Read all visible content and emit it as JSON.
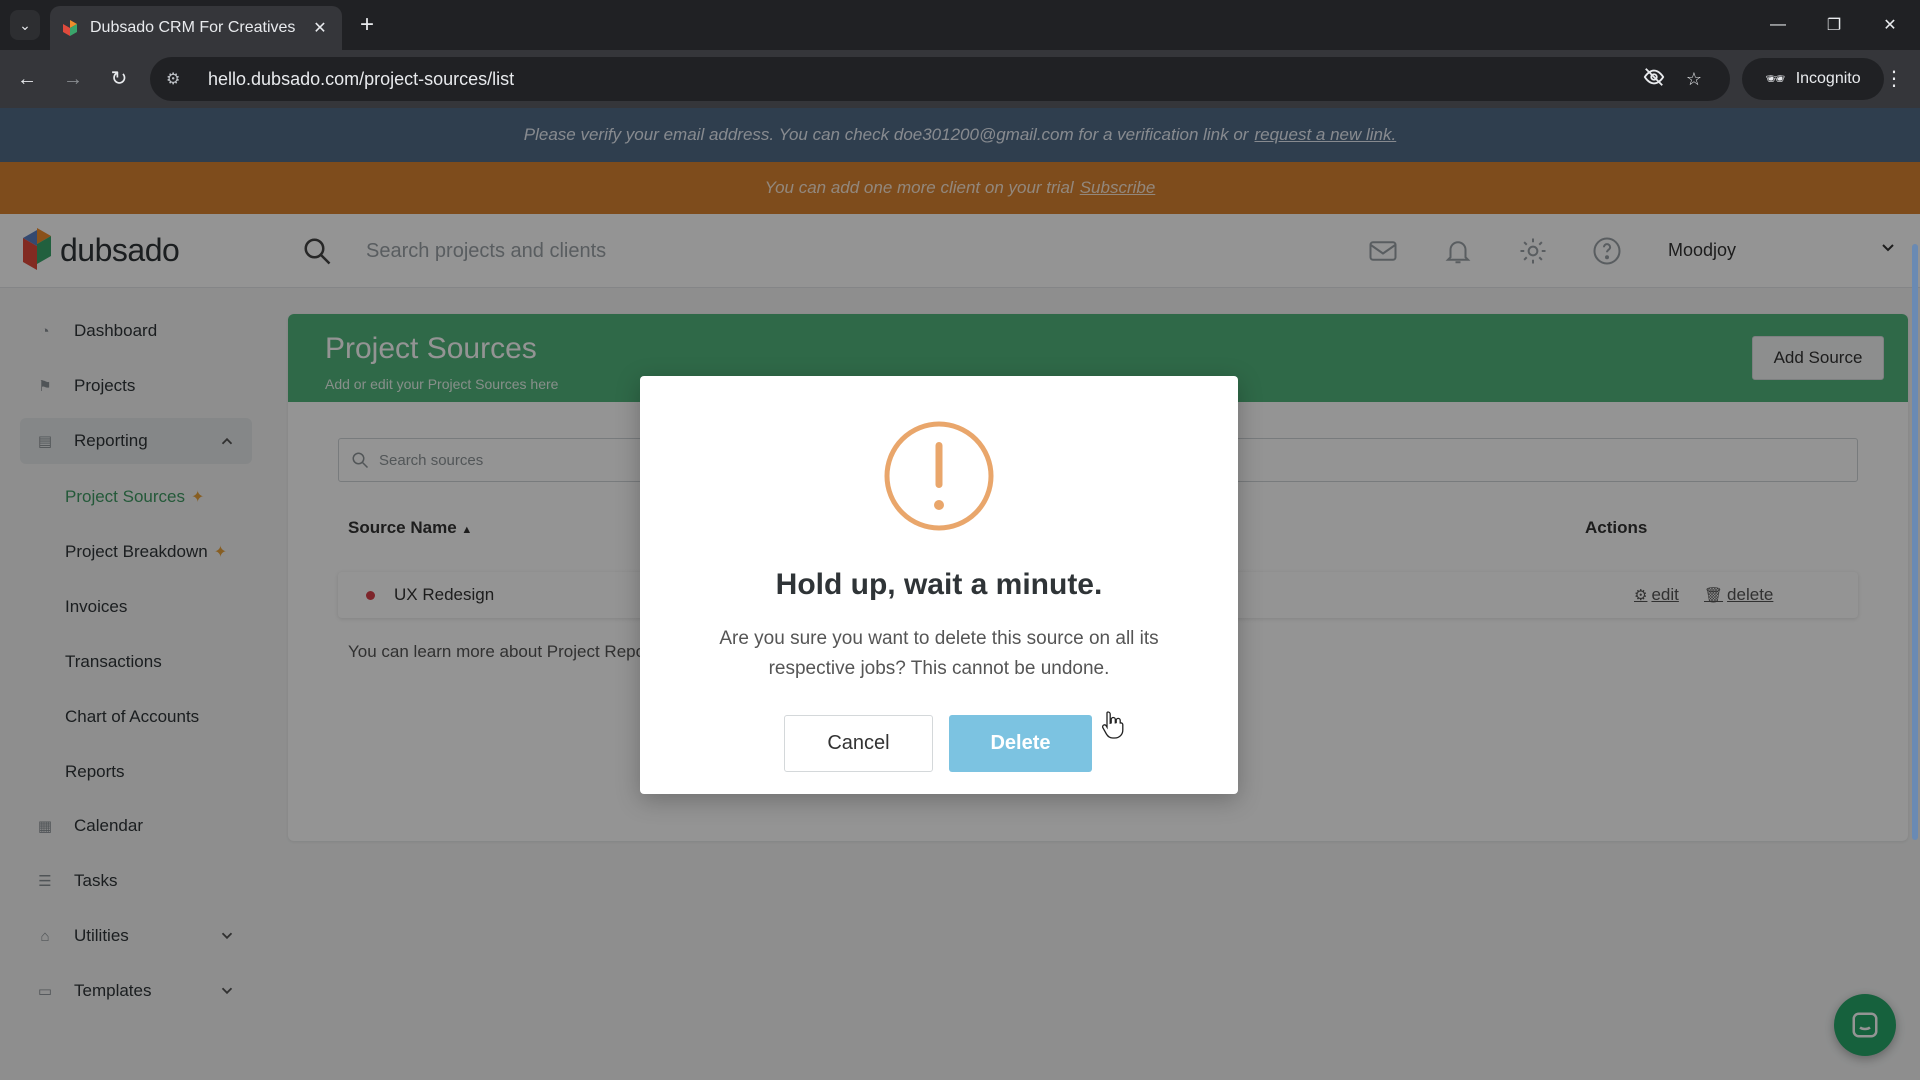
{
  "browser": {
    "tab_title": "Dubsado CRM For Creatives",
    "url": "hello.dubsado.com/project-sources/list",
    "incognito_label": "Incognito"
  },
  "banners": {
    "verify_text": "Please verify your email address. You can check doe301200@gmail.com for a verification link or",
    "verify_link": "request a new link.",
    "trial_text": "You can add one more client on your trial",
    "trial_link": "Subscribe"
  },
  "header": {
    "logo_text": "dubsado",
    "search_placeholder": "Search projects and clients",
    "user_name": "Moodjoy"
  },
  "sidebar": {
    "items": [
      {
        "label": "Dashboard",
        "icon": "dashboard-icon"
      },
      {
        "label": "Projects",
        "icon": "projects-icon"
      },
      {
        "label": "Reporting",
        "icon": "reporting-icon"
      },
      {
        "label": "Calendar",
        "icon": "calendar-icon"
      },
      {
        "label": "Tasks",
        "icon": "tasks-icon"
      },
      {
        "label": "Utilities",
        "icon": "utilities-icon"
      },
      {
        "label": "Templates",
        "icon": "templates-icon"
      }
    ],
    "reporting_sub": [
      {
        "label": "Project Sources"
      },
      {
        "label": "Project Breakdown"
      },
      {
        "label": "Invoices"
      },
      {
        "label": "Transactions"
      },
      {
        "label": "Chart of Accounts"
      },
      {
        "label": "Reports"
      }
    ]
  },
  "main": {
    "title": "Project Sources",
    "subtitle": "Add or edit your Project Sources here",
    "add_button": "Add Source",
    "search_placeholder": "Search sources",
    "columns": {
      "name": "Source Name",
      "actions": "Actions"
    },
    "rows": [
      {
        "name": "UX Redesign",
        "edit": "edit",
        "delete": "delete"
      }
    ],
    "learn_more": "You can learn more about Project Repo"
  },
  "modal": {
    "title": "Hold up, wait a minute.",
    "message": "Are you sure you want to delete this source on all its respective jobs? This cannot be undone.",
    "cancel": "Cancel",
    "delete": "Delete"
  },
  "colors": {
    "brand_green": "#52b57c",
    "verify_banner": "#516b87",
    "trial_banner": "#d98331",
    "warning": "#e9a66b",
    "delete_button": "#7cc3e1"
  }
}
